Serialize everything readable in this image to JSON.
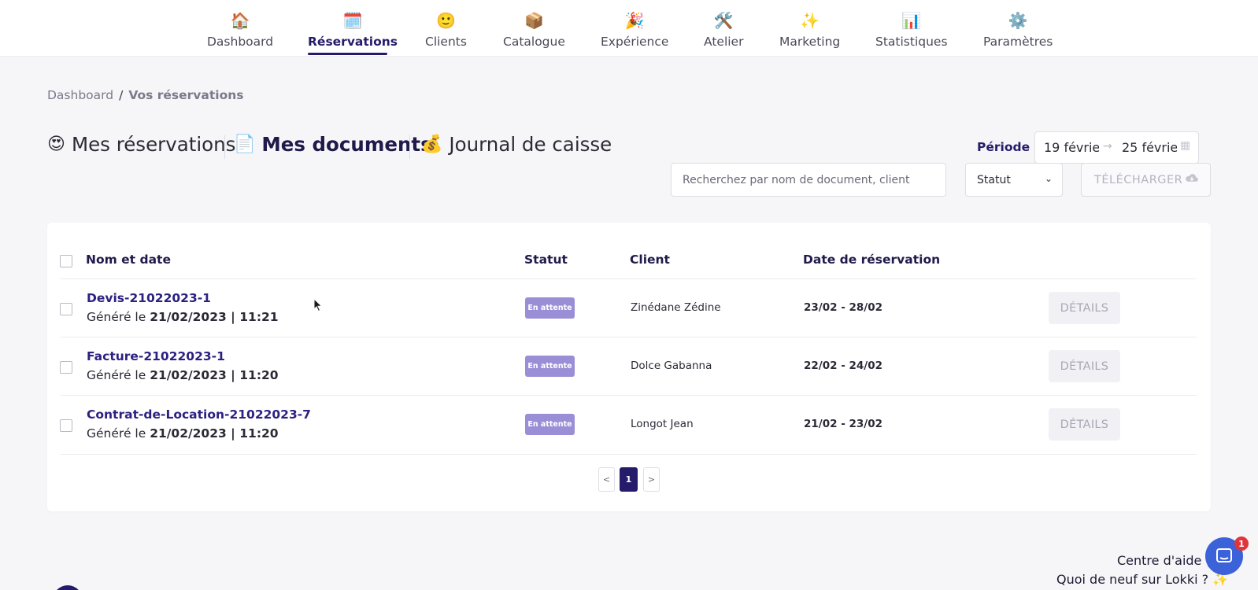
{
  "nav": {
    "items": [
      {
        "icon": "house-icon",
        "emoji": "🏠",
        "label": "Dashboard"
      },
      {
        "icon": "calendar-icon",
        "emoji": "🗓️",
        "label": "Réservations"
      },
      {
        "icon": "smiley-icon",
        "emoji": "🙂",
        "label": "Clients"
      },
      {
        "icon": "package-icon",
        "emoji": "📦",
        "label": "Catalogue"
      },
      {
        "icon": "party-popper-icon",
        "emoji": "🎉",
        "label": "Expérience"
      },
      {
        "icon": "tools-icon",
        "emoji": "🛠️",
        "label": "Atelier"
      },
      {
        "icon": "sparkles-icon",
        "emoji": "✨",
        "label": "Marketing"
      },
      {
        "icon": "bar-chart-icon",
        "emoji": "📊",
        "label": "Statistiques"
      },
      {
        "icon": "gear-icon",
        "emoji": "⚙️",
        "label": "Paramètres"
      }
    ],
    "active": "Réservations"
  },
  "breadcrumb": {
    "root": "Dashboard",
    "separator": "/",
    "current": "Vos réservations"
  },
  "tabs": [
    {
      "emoji": "😍",
      "icon": "heart-eyes-icon",
      "label": "Mes réservations"
    },
    {
      "emoji": "📄",
      "icon": "document-icon",
      "label": "Mes documents"
    },
    {
      "emoji": "💰",
      "icon": "money-bag-icon",
      "label": "Journal de caisse"
    }
  ],
  "active_tab": "Mes documents",
  "period": {
    "label": "Période :",
    "start": "19 février",
    "end": "25 février"
  },
  "search": {
    "placeholder": "Recherchez par nom de document, client"
  },
  "status_filter": {
    "label": "Statut"
  },
  "download_button": {
    "label": "TÉLÉCHARGER"
  },
  "table": {
    "headers": {
      "name": "Nom et date",
      "status": "Statut",
      "client": "Client",
      "date": "Date de réservation"
    },
    "rows": [
      {
        "name": "Devis-21022023-1",
        "date_label": "Généré le",
        "generated": "21/02/2023 | 11:21",
        "status": "En attente",
        "client": "Zinédane Zédine",
        "dates": "23/02 - 28/02",
        "action": "DÉTAILS"
      },
      {
        "name": "Facture-21022023-1",
        "date_label": "Généré le",
        "generated": "21/02/2023 | 11:20",
        "status": "En attente",
        "client": "Dolce Gabanna",
        "dates": "22/02 - 24/02",
        "action": "DÉTAILS"
      },
      {
        "name": "Contrat-de-Location-21022023-7",
        "date_label": "Généré le",
        "generated": "21/02/2023 | 11:20",
        "status": "En attente",
        "client": "Longot Jean",
        "dates": "21/02 - 23/02",
        "action": "DÉTAILS"
      }
    ]
  },
  "pagination": {
    "prev": "<",
    "current_page": "1",
    "next": ">"
  },
  "help": {
    "help_center": "Centre d'aide 📕",
    "whats_new": "Quoi de neuf sur Lokki ? ✨"
  },
  "chat": {
    "unread": "1"
  },
  "colors": {
    "brand": "#241c6b",
    "status_badge": "#9a8fd6",
    "chat": "#3b62d8",
    "notification": "#e0353a"
  }
}
